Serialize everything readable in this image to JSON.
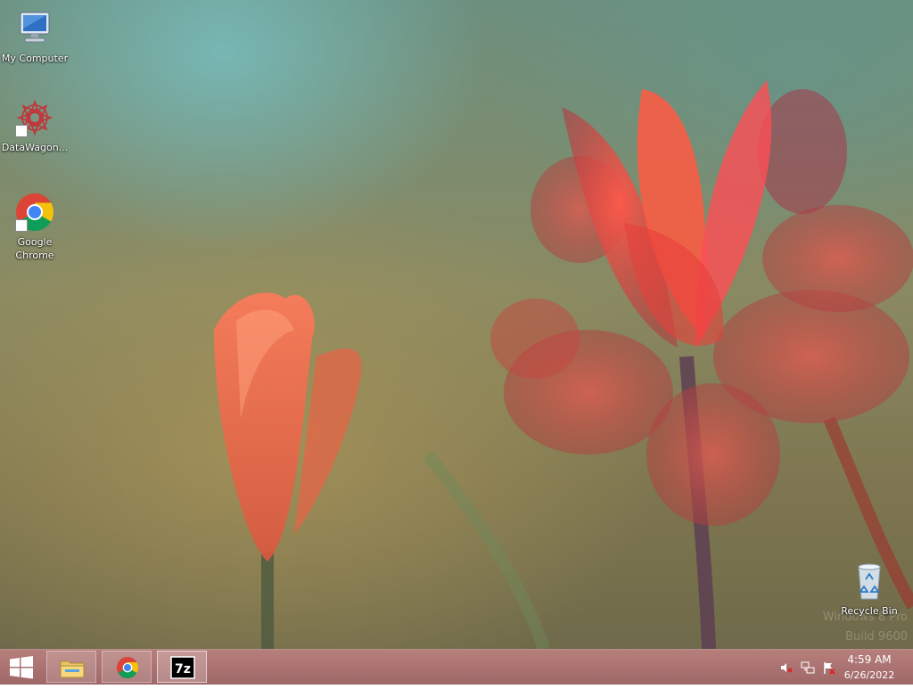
{
  "desktop": {
    "icons": [
      {
        "label": "My Computer",
        "icon": "computer-icon"
      },
      {
        "label": "DataWagon...",
        "icon": "datawagon-icon"
      },
      {
        "label": "Google Chrome",
        "icon": "chrome-icon"
      },
      {
        "label": "Recycle Bin",
        "icon": "recycle-bin-icon"
      }
    ],
    "watermark": {
      "line1": "Windows 8 Pro",
      "line2": "Build 9600"
    }
  },
  "taskbar": {
    "start": {
      "icon": "windows-logo-icon"
    },
    "pinned": [
      {
        "name": "File Explorer",
        "icon": "file-explorer-icon"
      },
      {
        "name": "Google Chrome",
        "icon": "chrome-icon"
      },
      {
        "name": "7-Zip",
        "icon": "7zip-icon",
        "glyph_text": "7z"
      }
    ],
    "tray": {
      "icons": [
        "volume-muted-icon",
        "network-icon",
        "action-center-flag-icon"
      ],
      "time": "4:59 AM",
      "date": "6/26/2022"
    }
  },
  "colors": {
    "taskbar": "#a86c6a",
    "chrome_red": "#db4437",
    "chrome_yellow": "#f4c20d",
    "chrome_green": "#0f9d58",
    "chrome_blue": "#4285f4"
  }
}
